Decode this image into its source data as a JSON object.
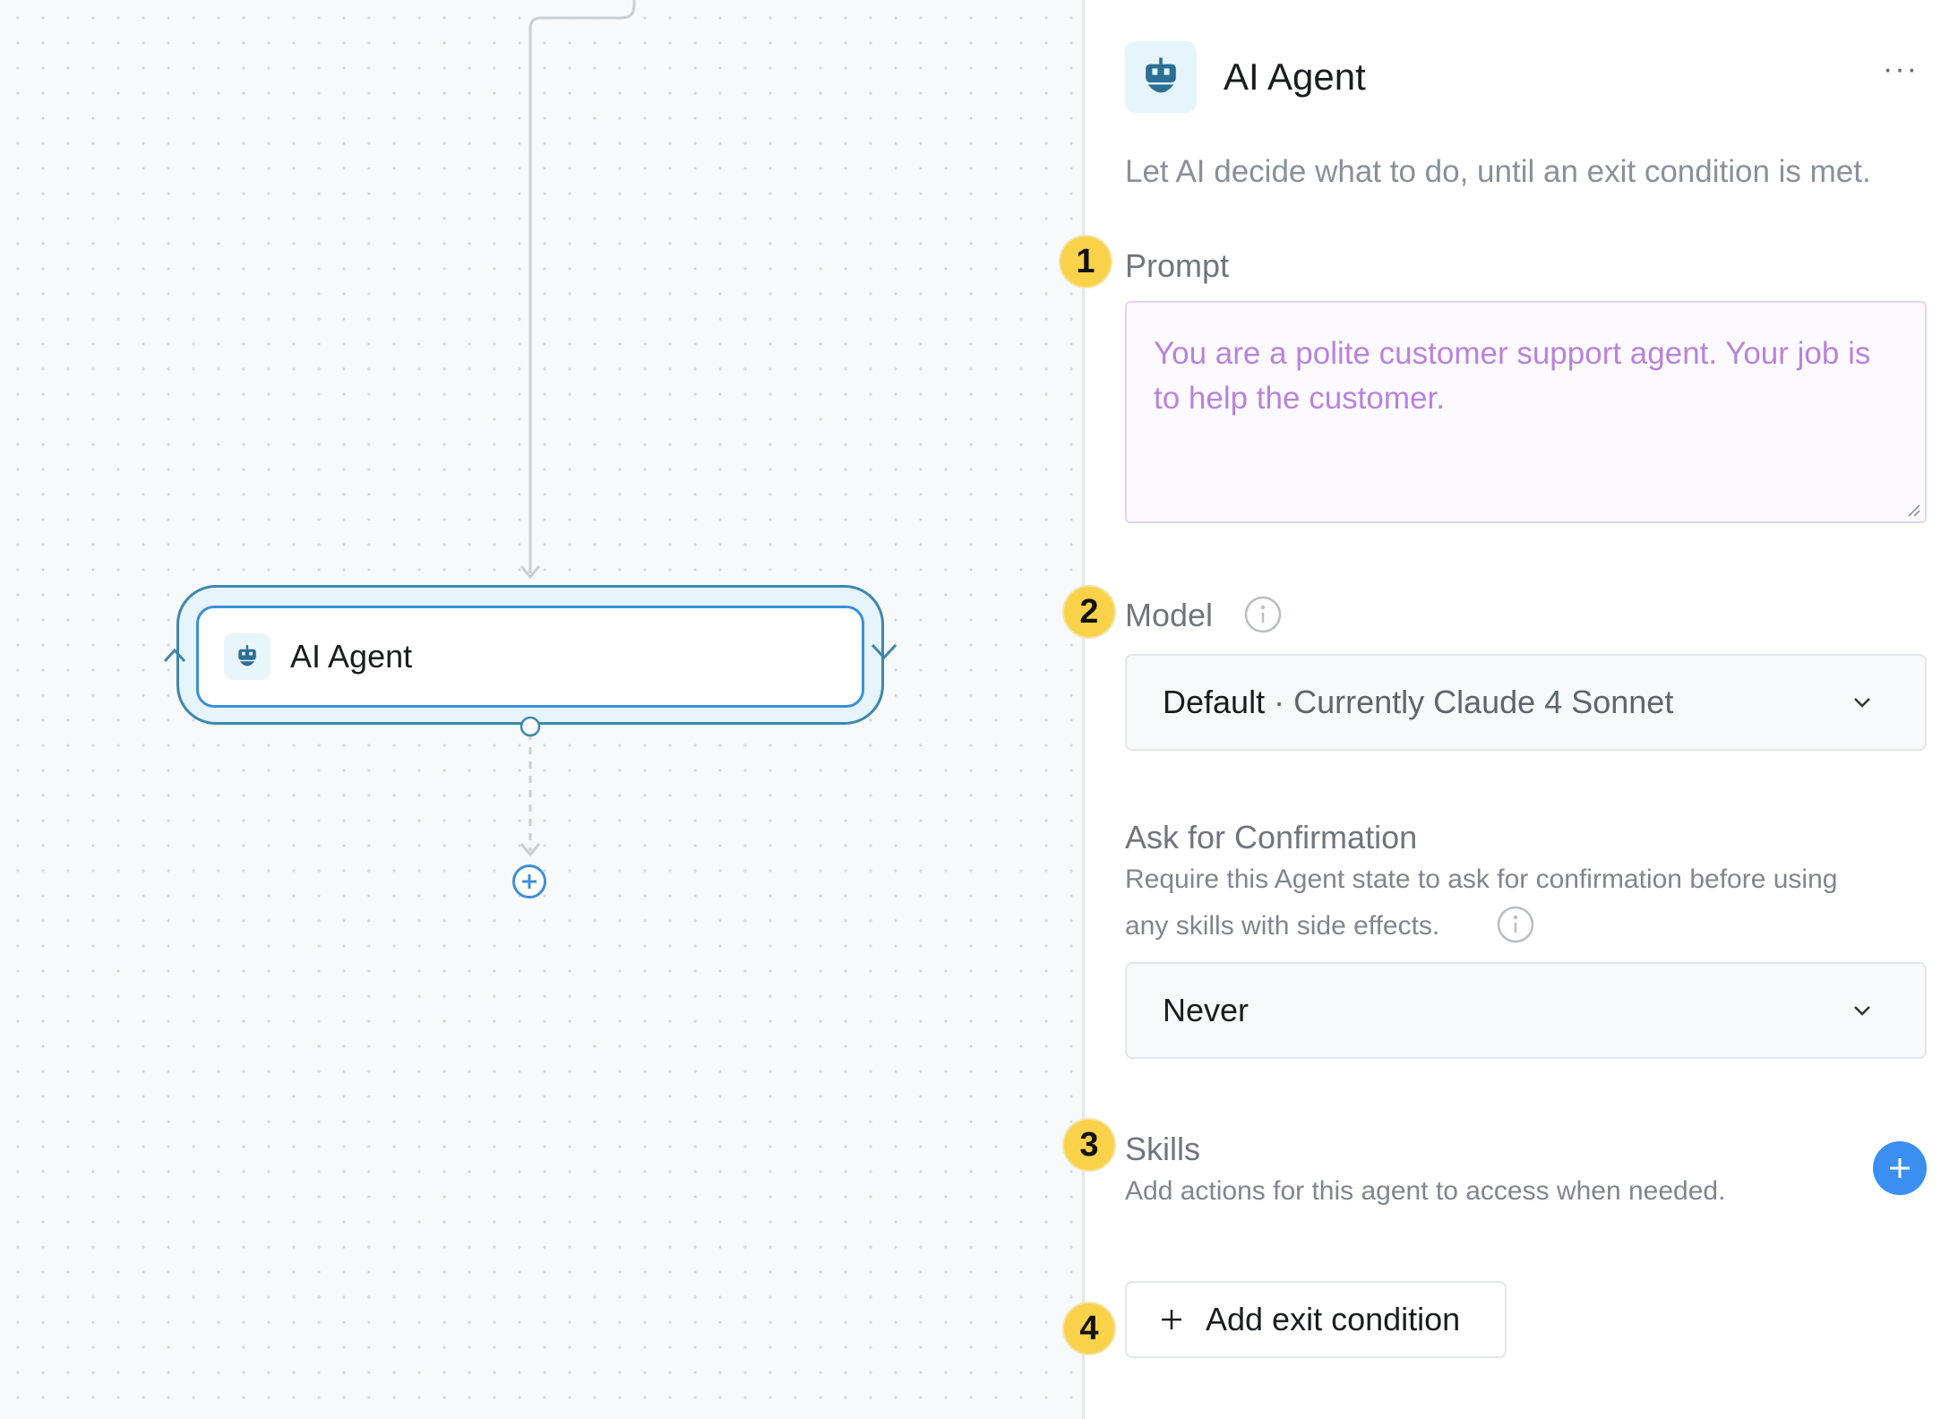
{
  "canvas": {
    "node": {
      "title": "AI Agent",
      "icon": "robot-icon"
    },
    "add_node_icon": "plus-circle-icon"
  },
  "panel": {
    "header": {
      "title": "AI Agent",
      "icon": "robot-icon",
      "menu_label": "···"
    },
    "description": "Let AI decide what to do, until an exit condition is met.",
    "prompt": {
      "badge": "1",
      "label": "Prompt",
      "value": "You are a polite customer support agent. Your job is to help the customer."
    },
    "model": {
      "badge": "2",
      "label": "Model",
      "selected_primary": "Default",
      "selected_secondary": " · Currently Claude 4 Sonnet"
    },
    "confirmation": {
      "label": "Ask for Confirmation",
      "help_line1": "Require this Agent state to ask for confirmation before using",
      "help_line2": "any skills with side effects.",
      "selected": "Never"
    },
    "skills": {
      "badge": "3",
      "label": "Skills",
      "help": "Add actions for this agent to access when needed."
    },
    "exit": {
      "badge": "4",
      "button_label": "Add exit condition"
    }
  },
  "colors": {
    "accent_blue": "#3a8ff0",
    "badge_yellow": "#f9d24a",
    "prompt_text": "#b883dc",
    "node_border": "#3f87a9"
  }
}
